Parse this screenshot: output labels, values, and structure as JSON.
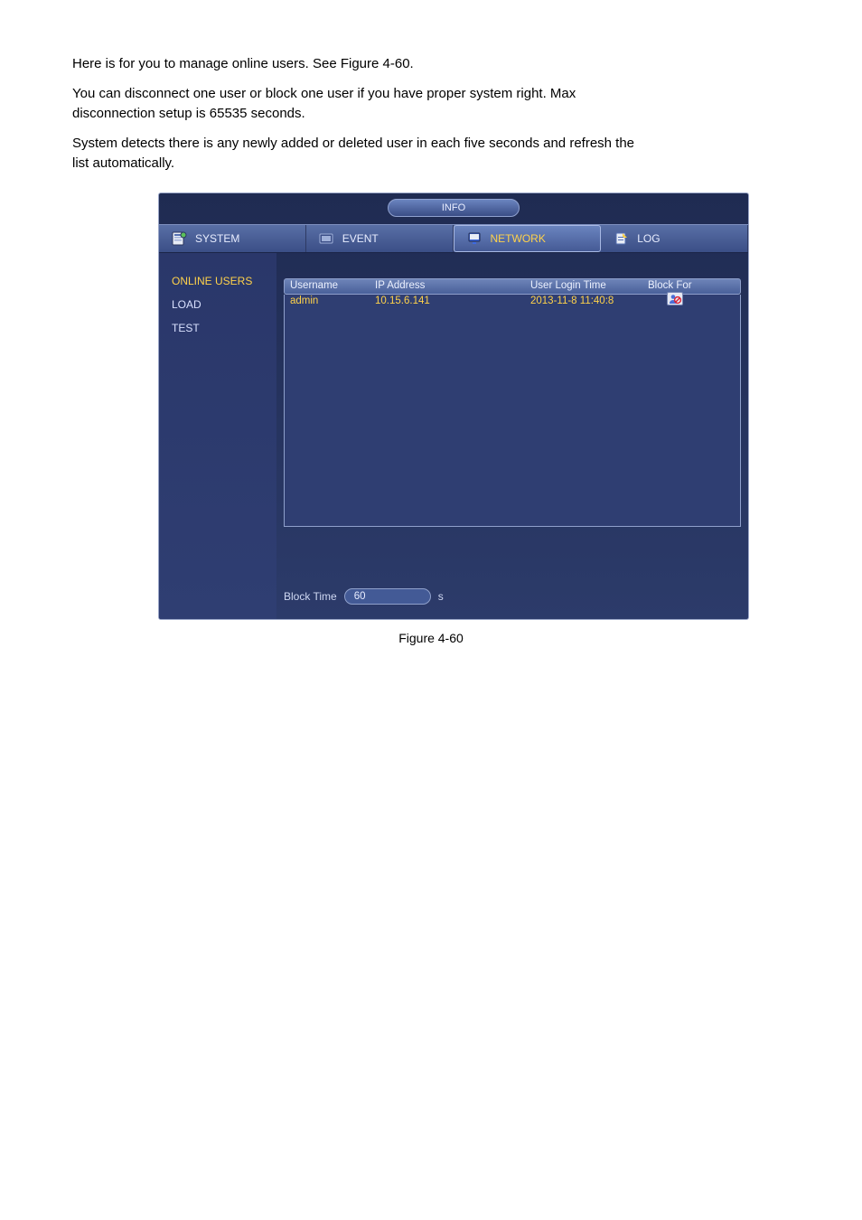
{
  "doc": {
    "para1": "Here is for you to manage online users. See Figure 4-60.",
    "para2_pre": "You can disconnect one user or block one user if you have proper system right. Max disconnection setup is 65535 seconds.",
    "para3_pre": "System detects there is any newly added or deleted user in each five seconds and refresh the list automatically.",
    "figure_caption": "Figure 4-60"
  },
  "info_dialog": {
    "title": "INFO",
    "tabs": {
      "system": "SYSTEM",
      "event": "EVENT",
      "network": "NETWORK",
      "log": "LOG"
    },
    "sidebar": {
      "online_users": "ONLINE USERS",
      "load": "LOAD",
      "test": "TEST"
    },
    "table": {
      "headers": {
        "username": "Username",
        "ip": "IP Address",
        "login_time": "User Login Time",
        "block_for": "Block For"
      },
      "rows": [
        {
          "username": "admin",
          "ip": "10.15.6.141",
          "login_time": "2013-11-8 11:40:8"
        }
      ]
    },
    "block_time": {
      "label": "Block Time",
      "value": "60",
      "unit": "s"
    }
  }
}
